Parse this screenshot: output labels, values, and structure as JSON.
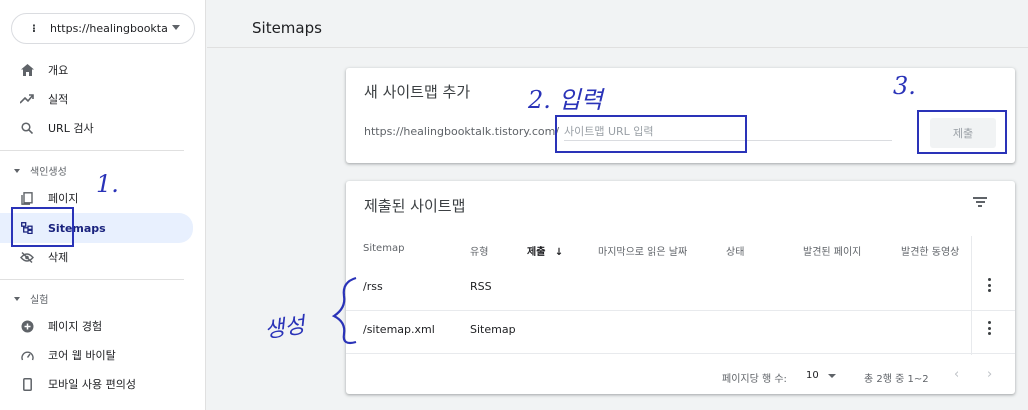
{
  "property": {
    "name": "https://healingbooktalk..."
  },
  "nav": {
    "overview": "개요",
    "performance": "실적",
    "url_inspection": "URL 검사",
    "indexing_section": "색인생성",
    "pages": "페이지",
    "sitemaps": "Sitemaps",
    "removals": "삭제",
    "experience_section": "실험",
    "page_experience": "페이지 경험",
    "core_web_vitals": "코어 웹 바이탈",
    "mobile_usability": "모바일 사용 편의성"
  },
  "main": {
    "title": "Sitemaps",
    "add_card": {
      "title": "새 사이트맵 추가",
      "prefix": "https://healingbooktalk.tistory.com/",
      "placeholder": "사이트맵 URL 입력",
      "submit": "제출"
    },
    "submitted_card": {
      "title": "제출된 사이트맵",
      "columns": [
        "Sitemap",
        "유형",
        "제출",
        "마지막으로 읽은 날짜",
        "상태",
        "발견된 페이지",
        "발견한 동영상"
      ],
      "rows": [
        {
          "sitemap": "/rss",
          "type": "RSS"
        },
        {
          "sitemap": "/sitemap.xml",
          "type": "Sitemap"
        }
      ],
      "pager": {
        "rows_per_page_label": "페이지당 행 수:",
        "rows_per_page": "10",
        "range": "총 2행 중 1~2"
      }
    }
  },
  "annotations": {
    "step1": "1.",
    "step2": "2. 입력",
    "step3": "3.",
    "created": "생성"
  },
  "colors": {
    "annotation": "#2a33b8",
    "active_nav_bg": "#e8f0fe",
    "active_nav_text": "#1a237e"
  }
}
